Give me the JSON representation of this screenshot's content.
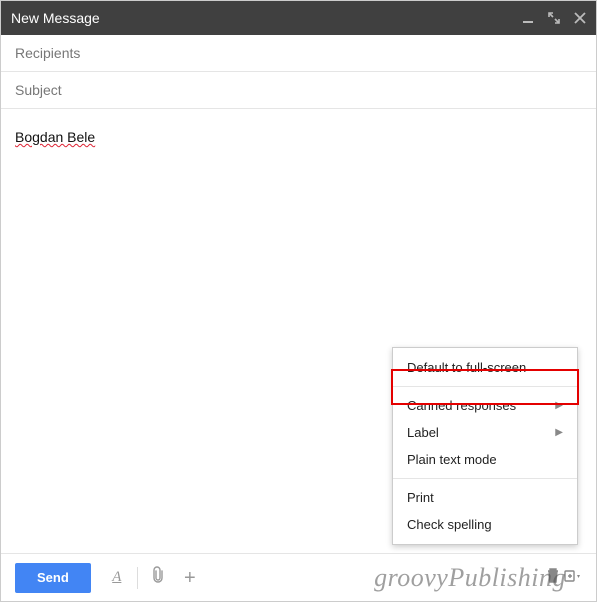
{
  "header": {
    "title": "New Message"
  },
  "fields": {
    "recipients_placeholder": "Recipients",
    "subject_placeholder": "Subject"
  },
  "body": {
    "text": "Bogdan Bele"
  },
  "menu": {
    "default_fullscreen": "Default to full-screen",
    "canned": "Canned responses",
    "label": "Label",
    "plaintext": "Plain text mode",
    "print": "Print",
    "spellcheck": "Check spelling"
  },
  "toolbar": {
    "send": "Send"
  },
  "watermark": "groovyPublishing"
}
